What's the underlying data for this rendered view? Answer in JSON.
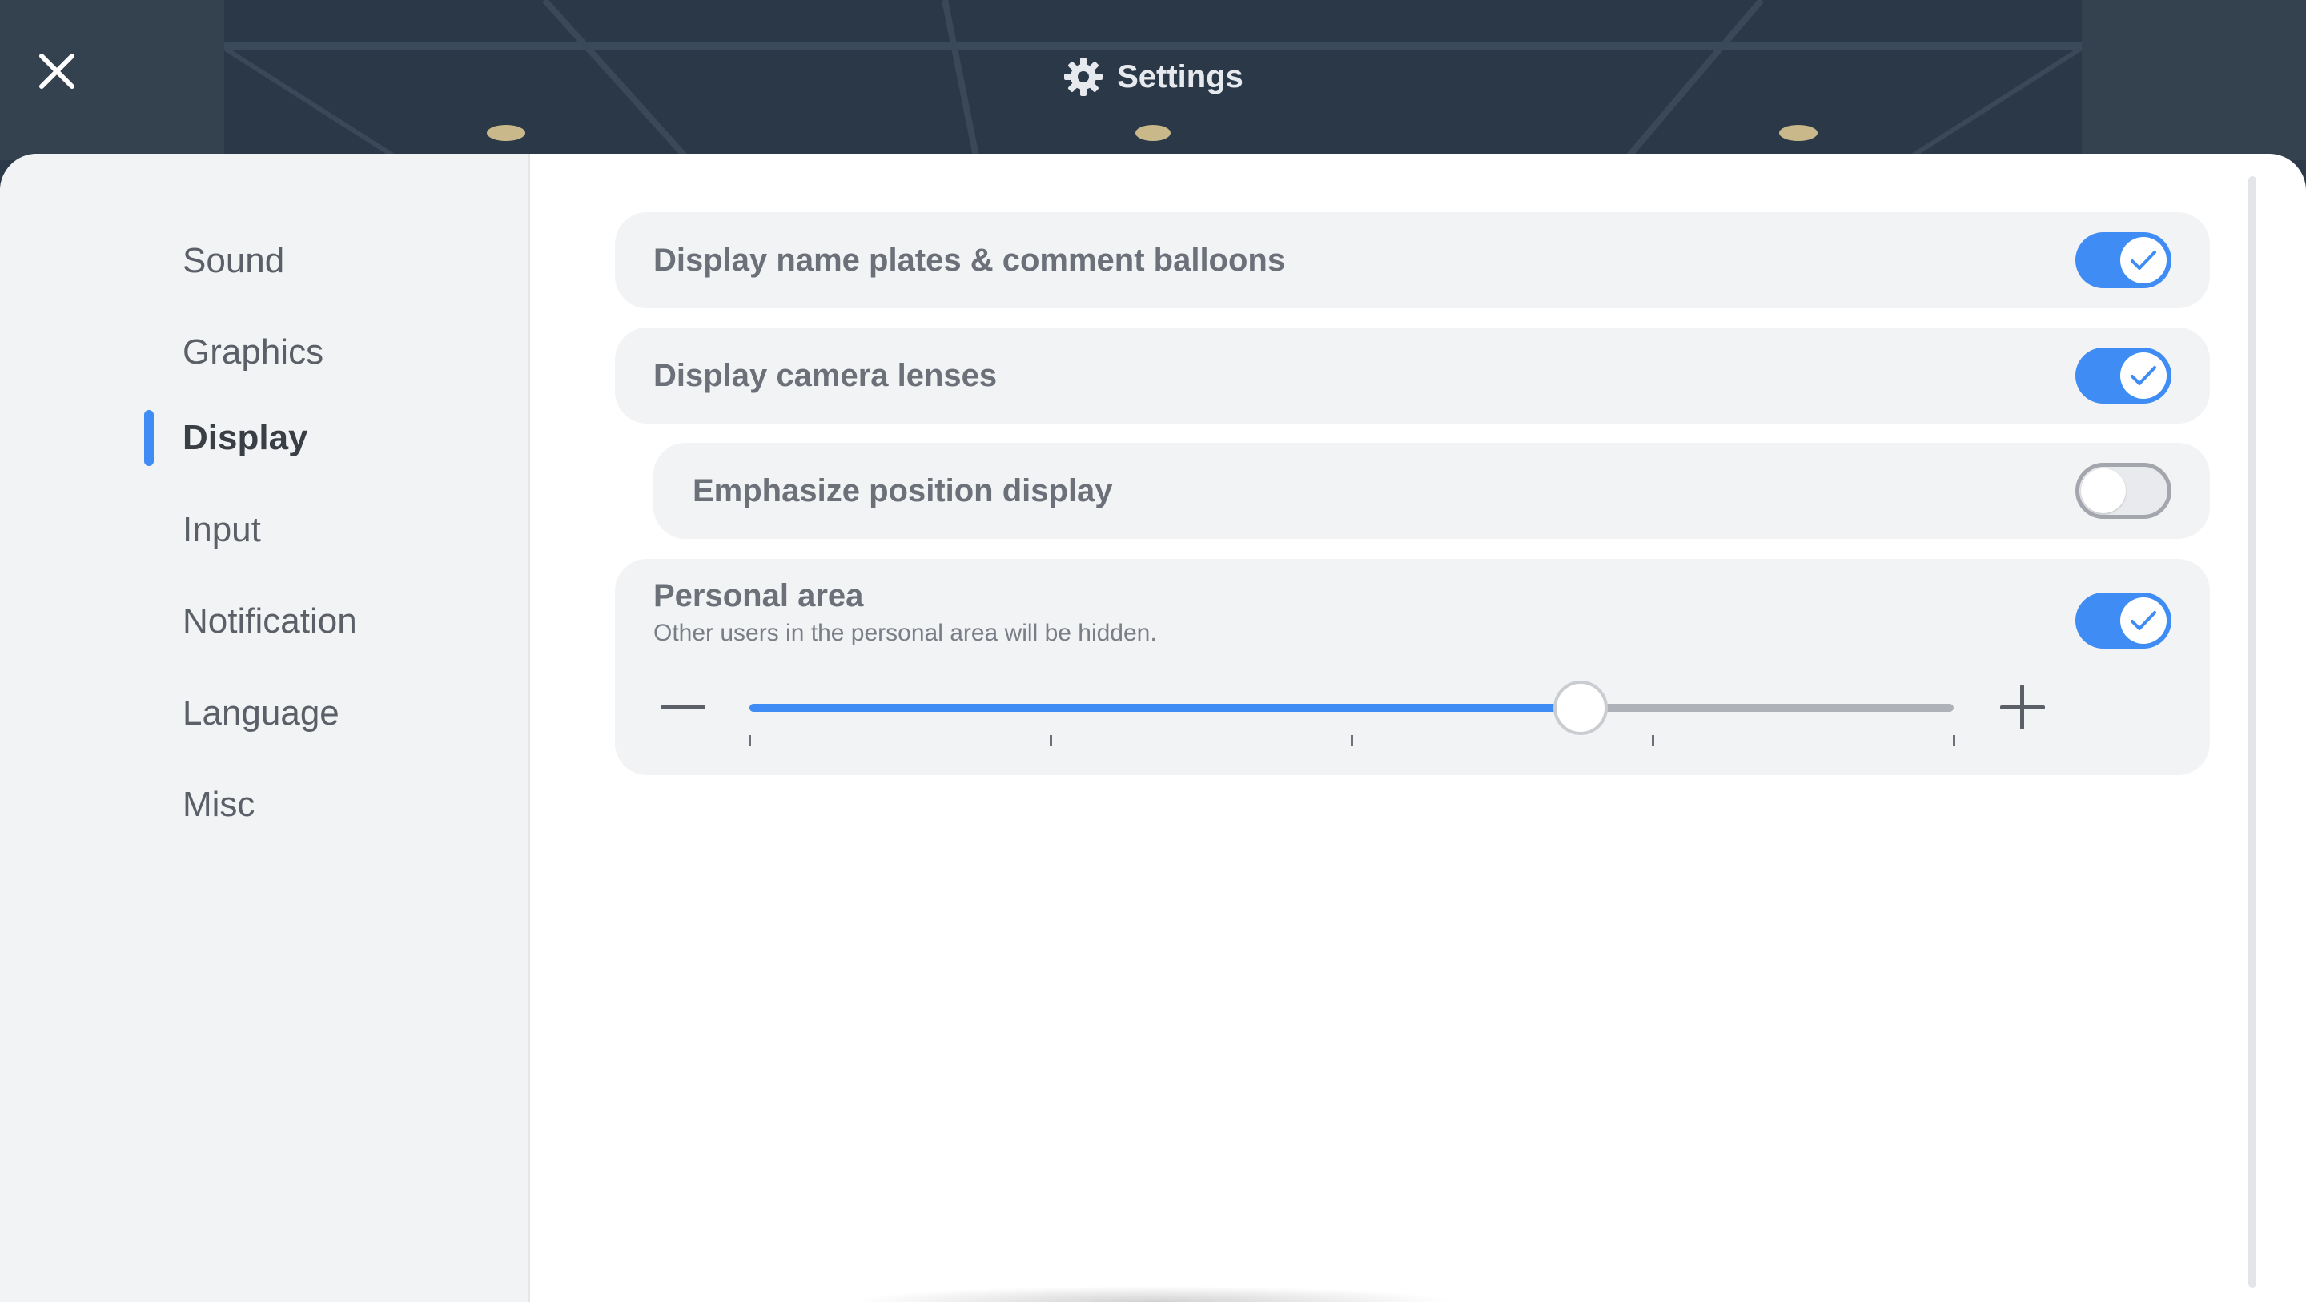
{
  "header": {
    "title": "Settings",
    "icon": "gear-icon",
    "close_icon": "close-icon"
  },
  "sidebar": {
    "items": [
      {
        "label": "Sound",
        "active": false
      },
      {
        "label": "Graphics",
        "active": false
      },
      {
        "label": "Display",
        "active": true
      },
      {
        "label": "Input",
        "active": false
      },
      {
        "label": "Notification",
        "active": false
      },
      {
        "label": "Language",
        "active": false
      },
      {
        "label": "Misc",
        "active": false
      }
    ]
  },
  "display_settings": {
    "name_plates": {
      "label": "Display name plates & comment balloons",
      "enabled": true
    },
    "camera_lenses": {
      "label": "Display camera lenses",
      "enabled": true
    },
    "emphasize_position": {
      "label": "Emphasize position display",
      "enabled": false
    },
    "personal_area": {
      "label": "Personal area",
      "description": "Other users in the personal area will be hidden.",
      "enabled": true,
      "slider": {
        "steps": 5,
        "value_fraction": 0.69,
        "decrease_icon": "minus-icon",
        "increase_icon": "plus-icon"
      }
    }
  },
  "colors": {
    "accent": "#3f8cf4",
    "background_dark": "#2c3a4a",
    "panel": "#ffffff",
    "sidebar": "#f2f3f5"
  }
}
